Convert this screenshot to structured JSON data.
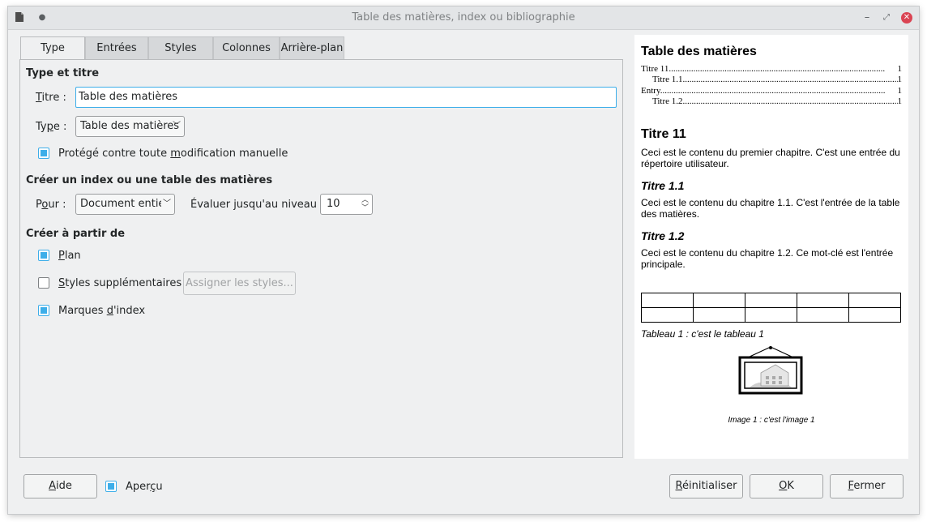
{
  "window": {
    "title": "Table des matières, index ou bibliographie"
  },
  "tabs": [
    "Type",
    "Entrées",
    "Styles",
    "Colonnes",
    "Arrière-plan"
  ],
  "type_section": {
    "heading": "Type et titre",
    "title_label": "Titre :",
    "title_value": "Table des matières",
    "type_label": "Type :",
    "type_value": "Table des matières",
    "protected_label": "Protégé contre toute modification manuelle",
    "protected_checked": true
  },
  "create_section": {
    "heading": "Créer un index ou une table des matières",
    "for_label": "Pour :",
    "for_value": "Document entier",
    "level_label": "Évaluer jusqu'au niveau :",
    "level_value": "10"
  },
  "from_section": {
    "heading": "Créer à partir de",
    "outline_label": "Plan",
    "outline_checked": true,
    "styles_label": "Styles supplémentaires",
    "styles_checked": false,
    "assign_button": "Assigner les styles...",
    "marks_label": "Marques d'index",
    "marks_checked": true
  },
  "preview": {
    "toc_title": "Table des matières",
    "toc_entries": [
      {
        "text": "Titre 11",
        "page": "1"
      },
      {
        "text": "Titre 1.1",
        "page": "1"
      },
      {
        "text": "Entry",
        "page": "1"
      },
      {
        "text": "Titre 1.2",
        "page": "1"
      }
    ],
    "h1": "Titre 11",
    "p1": "Ceci est le contenu du premier chapitre. C'est une entrée du répertoire utilisateur.",
    "h2a": "Titre 1.1",
    "p2": "Ceci est le contenu du chapitre 1.1. C'est l'entrée de la table des matières.",
    "h2b": "Titre 1.2",
    "p3": "Ceci est le contenu du chapitre 1.2. Ce mot-clé est l'entrée principale.",
    "table_caption": "Tableau 1 : c'est le tableau 1",
    "image_caption": "Image 1 : c'est l'image 1"
  },
  "footer": {
    "help": "Aide",
    "preview_label": "Aperçu",
    "preview_checked": true,
    "reset": "Réinitialiser",
    "ok": "OK",
    "close": "Fermer"
  },
  "colors": {
    "accent": "#3daee9",
    "close": "#da4453"
  }
}
